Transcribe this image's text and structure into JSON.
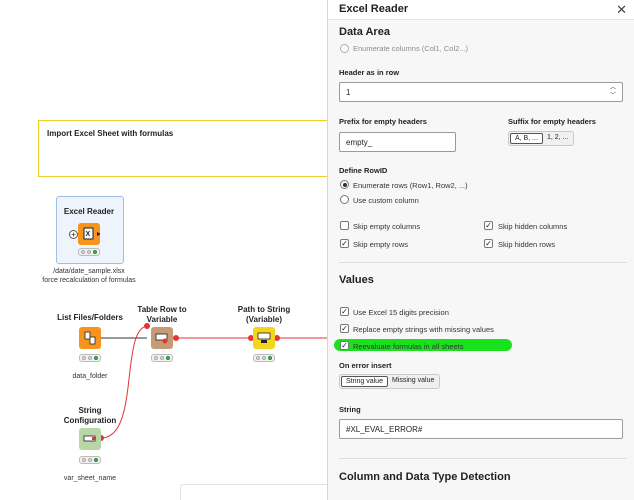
{
  "canvas": {
    "annotation": "Import Excel Sheet with formulas",
    "nodes": {
      "excel_reader": {
        "title": "Excel Reader",
        "label_line1": "/data/date_sample.xlsx",
        "label_line2": "force recalculation of formulas"
      },
      "list_files": {
        "title": "List Files/Folders",
        "label": "data_folder"
      },
      "table_row": {
        "title_line1": "Table Row to",
        "title_line2": "Variable"
      },
      "path_to_string": {
        "title_line1": "Path to String",
        "title_line2": "(Variable)"
      },
      "string_config": {
        "title_line1": "String",
        "title_line2": "Configuration",
        "label": "var_sheet_name"
      }
    }
  },
  "panel": {
    "title": "Excel Reader",
    "close_icon": "close-icon",
    "data_area": {
      "heading": "Data Area",
      "enumerate_columns_option": "Enumerate columns (Col1, Col2...)",
      "header_as_in_row_label": "Header as in row",
      "header_as_in_row_value": "1",
      "prefix_label": "Prefix for empty headers",
      "prefix_value": "empty_",
      "suffix_label": "Suffix for empty headers",
      "suffix_options": [
        "A, B, ...",
        "1, 2, ..."
      ],
      "define_rowid_label": "Define RowID",
      "rowid_options": [
        "Enumerate rows (Row1, Row2, ...)",
        "Use custom column"
      ],
      "skip_empty_columns": "Skip empty columns",
      "skip_hidden_columns": "Skip hidden columns",
      "skip_empty_rows": "Skip empty rows",
      "skip_hidden_rows": "Skip hidden rows"
    },
    "values": {
      "heading": "Values",
      "use_excel_15": "Use Excel 15 digits precision",
      "replace_empty": "Replace empty strings with missing values",
      "reevaluate": "Reevaluate formulas in all sheets",
      "on_error_label": "On error insert",
      "on_error_options": [
        "String value",
        "Missing value"
      ],
      "string_label": "String",
      "string_value": "#XL_EVAL_ERROR#"
    },
    "detection": {
      "heading": "Column and Data Type Detection"
    }
  },
  "colors": {
    "annotation_border": "#f2cd2f",
    "source_node": "#f7941d",
    "manipulator_node": "#c69a74",
    "converter_node": "#f4d51e",
    "config_node": "#b9d7a6",
    "flow_variable_line": "#e23636",
    "highlight": "#19e21d"
  }
}
